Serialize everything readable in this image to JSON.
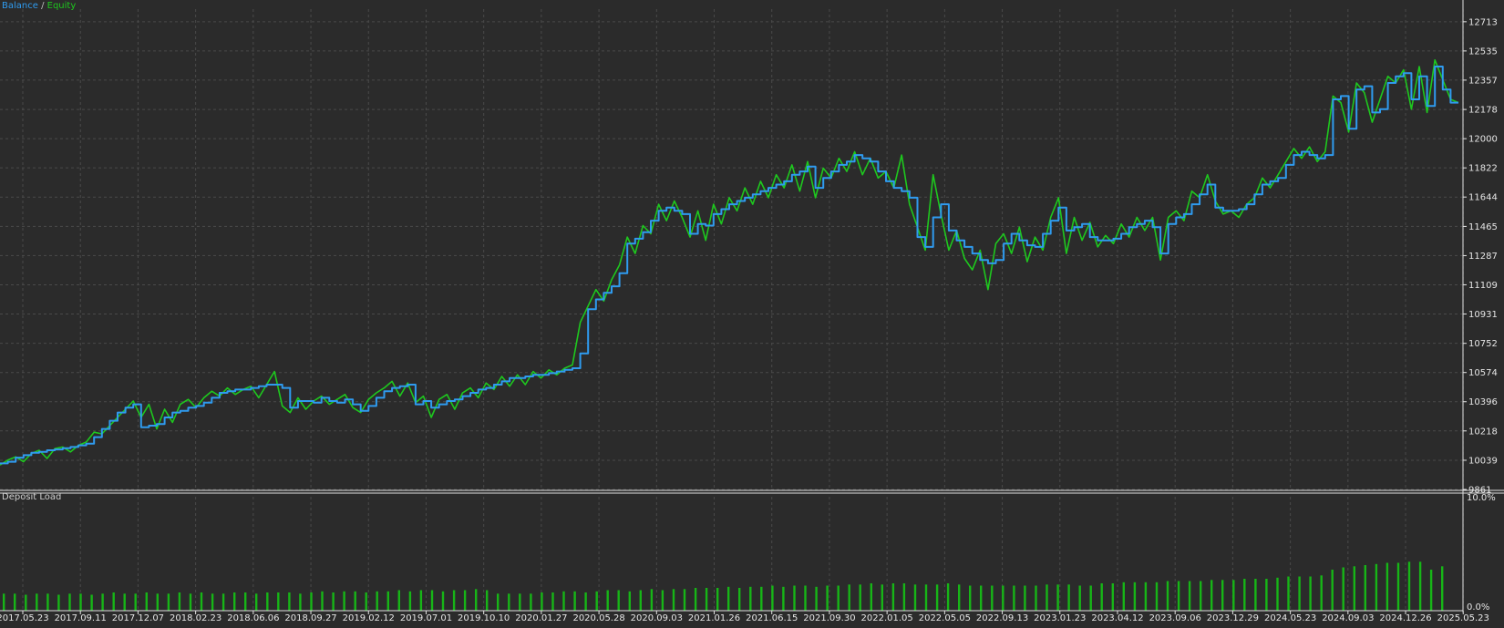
{
  "legend": {
    "balance_label": "Balance",
    "separator": " / ",
    "equity_label": "Equity"
  },
  "colors": {
    "background": "#2b2b2b",
    "grid": "#4a4a4a",
    "axis_text": "#e6e6e6",
    "balance": "#2f9bef",
    "equity": "#1ec81e",
    "deposit_load": "#17b517"
  },
  "chart_data": [
    {
      "type": "line",
      "title": "",
      "xlabel": "",
      "ylabel": "",
      "grid": true,
      "legend_position": "top-left",
      "x_tick_labels": [
        "2017.05.23",
        "2017.09.11",
        "2017.12.07",
        "2018.02.23",
        "2018.06.06",
        "2018.09.27",
        "2019.02.12",
        "2019.07.01",
        "2019.10.10",
        "2020.01.27",
        "2020.05.28",
        "2020.09.03",
        "2021.01.26",
        "2021.06.15",
        "2021.09.30",
        "2022.01.05",
        "2022.05.05",
        "2022.09.13",
        "2023.01.23",
        "2023.04.12",
        "2023.09.06",
        "2023.12.29",
        "2024.05.23",
        "2024.09.03",
        "2024.12.26",
        "2025.05.23"
      ],
      "y_tick_labels": [
        "9861",
        "10039",
        "10218",
        "10396",
        "10574",
        "10752",
        "10931",
        "11109",
        "11287",
        "11465",
        "11644",
        "11822",
        "12000",
        "12178",
        "12357",
        "12535",
        "12713"
      ],
      "ylim": [
        9861,
        12790
      ],
      "series": [
        {
          "name": "Balance",
          "values": [
            10020,
            10030,
            10055,
            10070,
            10085,
            10090,
            10100,
            10105,
            10112,
            10120,
            10130,
            10140,
            10180,
            10230,
            10280,
            10330,
            10360,
            10380,
            10240,
            10250,
            10260,
            10300,
            10330,
            10340,
            10360,
            10370,
            10390,
            10420,
            10450,
            10460,
            10470,
            10470,
            10480,
            10490,
            10500,
            10500,
            10480,
            10360,
            10400,
            10400,
            10390,
            10420,
            10400,
            10390,
            10410,
            10380,
            10340,
            10370,
            10420,
            10460,
            10480,
            10490,
            10500,
            10380,
            10400,
            10360,
            10380,
            10400,
            10410,
            10430,
            10450,
            10470,
            10480,
            10500,
            10520,
            10540,
            10540,
            10550,
            10560,
            10560,
            10570,
            10580,
            10590,
            10600,
            10690,
            10960,
            11020,
            11060,
            11100,
            11180,
            11360,
            11390,
            11430,
            11500,
            11560,
            11580,
            11560,
            11540,
            11420,
            11480,
            11470,
            11540,
            11570,
            11600,
            11620,
            11640,
            11660,
            11680,
            11700,
            11720,
            11740,
            11780,
            11800,
            11830,
            11700,
            11760,
            11800,
            11840,
            11860,
            11900,
            11880,
            11860,
            11800,
            11740,
            11700,
            11680,
            11640,
            11400,
            11340,
            11520,
            11600,
            11440,
            11380,
            11340,
            11300,
            11260,
            11240,
            11260,
            11360,
            11420,
            11380,
            11350,
            11340,
            11420,
            11500,
            11580,
            11440,
            11460,
            11480,
            11400,
            11380,
            11380,
            11390,
            11420,
            11460,
            11480,
            11500,
            11460,
            11300,
            11480,
            11520,
            11540,
            11600,
            11660,
            11720,
            11580,
            11560,
            11560,
            11570,
            11600,
            11660,
            11720,
            11740,
            11760,
            11840,
            11900,
            11920,
            11900,
            11880,
            11900,
            12240,
            12260,
            12060,
            12300,
            12320,
            12160,
            12180,
            12340,
            12380,
            12400,
            12240,
            12380,
            12200,
            12440,
            12300,
            12220,
            12220
          ],
          "color": "#2f9bef"
        },
        {
          "name": "Equity",
          "values": [
            10010,
            10040,
            10060,
            10030,
            10080,
            10100,
            10050,
            10110,
            10120,
            10090,
            10130,
            10150,
            10210,
            10200,
            10250,
            10300,
            10350,
            10400,
            10300,
            10380,
            10230,
            10350,
            10270,
            10380,
            10410,
            10360,
            10420,
            10460,
            10430,
            10480,
            10440,
            10470,
            10490,
            10420,
            10500,
            10580,
            10370,
            10330,
            10420,
            10350,
            10400,
            10430,
            10380,
            10410,
            10440,
            10360,
            10330,
            10410,
            10450,
            10480,
            10520,
            10430,
            10510,
            10390,
            10430,
            10300,
            10410,
            10440,
            10350,
            10450,
            10480,
            10420,
            10510,
            10470,
            10550,
            10490,
            10560,
            10500,
            10580,
            10540,
            10590,
            10560,
            10600,
            10620,
            10880,
            10980,
            11080,
            11010,
            11140,
            11230,
            11400,
            11300,
            11470,
            11420,
            11600,
            11500,
            11620,
            11520,
            11400,
            11560,
            11380,
            11600,
            11480,
            11640,
            11560,
            11700,
            11600,
            11740,
            11640,
            11780,
            11700,
            11840,
            11680,
            11860,
            11640,
            11820,
            11760,
            11880,
            11800,
            11920,
            11780,
            11880,
            11760,
            11800,
            11700,
            11900,
            11600,
            11460,
            11320,
            11780,
            11540,
            11320,
            11440,
            11270,
            11200,
            11320,
            11080,
            11360,
            11420,
            11300,
            11460,
            11250,
            11400,
            11320,
            11520,
            11640,
            11300,
            11520,
            11380,
            11490,
            11340,
            11410,
            11360,
            11480,
            11400,
            11520,
            11440,
            11520,
            11260,
            11520,
            11560,
            11500,
            11680,
            11640,
            11780,
            11620,
            11540,
            11560,
            11520,
            11600,
            11640,
            11760,
            11700,
            11780,
            11860,
            11940,
            11880,
            11950,
            11860,
            11920,
            12260,
            12220,
            12040,
            12340,
            12280,
            12100,
            12240,
            12380,
            12340,
            12420,
            12180,
            12440,
            12160,
            12480,
            12360,
            12240,
            12220
          ],
          "color": "#1ec81e"
        }
      ]
    },
    {
      "type": "bar",
      "title": "Deposit Load",
      "xlabel": "",
      "ylabel": "",
      "grid": false,
      "y_tick_labels": [
        "10.0%",
        "0.0%"
      ],
      "ylim": [
        0,
        10
      ],
      "values": [
        1.5,
        1.5,
        1.4,
        1.5,
        1.5,
        1.4,
        1.5,
        1.5,
        1.4,
        1.5,
        1.6,
        1.5,
        1.5,
        1.6,
        1.5,
        1.5,
        1.6,
        1.5,
        1.6,
        1.5,
        1.5,
        1.6,
        1.6,
        1.5,
        1.6,
        1.6,
        1.6,
        1.5,
        1.6,
        1.7,
        1.6,
        1.7,
        1.7,
        1.6,
        1.7,
        1.7,
        1.8,
        1.7,
        1.8,
        1.8,
        1.7,
        1.8,
        1.8,
        1.9,
        1.8,
        1.5,
        1.5,
        1.5,
        1.5,
        1.6,
        1.6,
        1.7,
        1.7,
        1.6,
        1.7,
        1.8,
        1.8,
        1.7,
        1.8,
        1.9,
        1.8,
        1.9,
        1.9,
        2.0,
        2.0,
        2.0,
        2.1,
        2.0,
        2.1,
        2.1,
        2.2,
        2.1,
        2.2,
        2.2,
        2.1,
        2.2,
        2.2,
        2.3,
        2.3,
        2.4,
        2.3,
        2.4,
        2.4,
        2.3,
        2.3,
        2.3,
        2.4,
        2.3,
        2.2,
        2.2,
        2.2,
        2.2,
        2.2,
        2.2,
        2.2,
        2.3,
        2.3,
        2.3,
        2.2,
        2.2,
        2.4,
        2.4,
        2.5,
        2.5,
        2.5,
        2.5,
        2.6,
        2.6,
        2.6,
        2.6,
        2.7,
        2.7,
        2.7,
        2.8,
        2.8,
        2.8,
        2.9,
        3.0,
        3.0,
        3.0,
        3.1,
        3.6,
        3.8,
        3.9,
        4.0,
        4.1,
        4.2,
        4.2,
        4.3,
        4.3,
        3.6,
        3.9
      ]
    }
  ]
}
